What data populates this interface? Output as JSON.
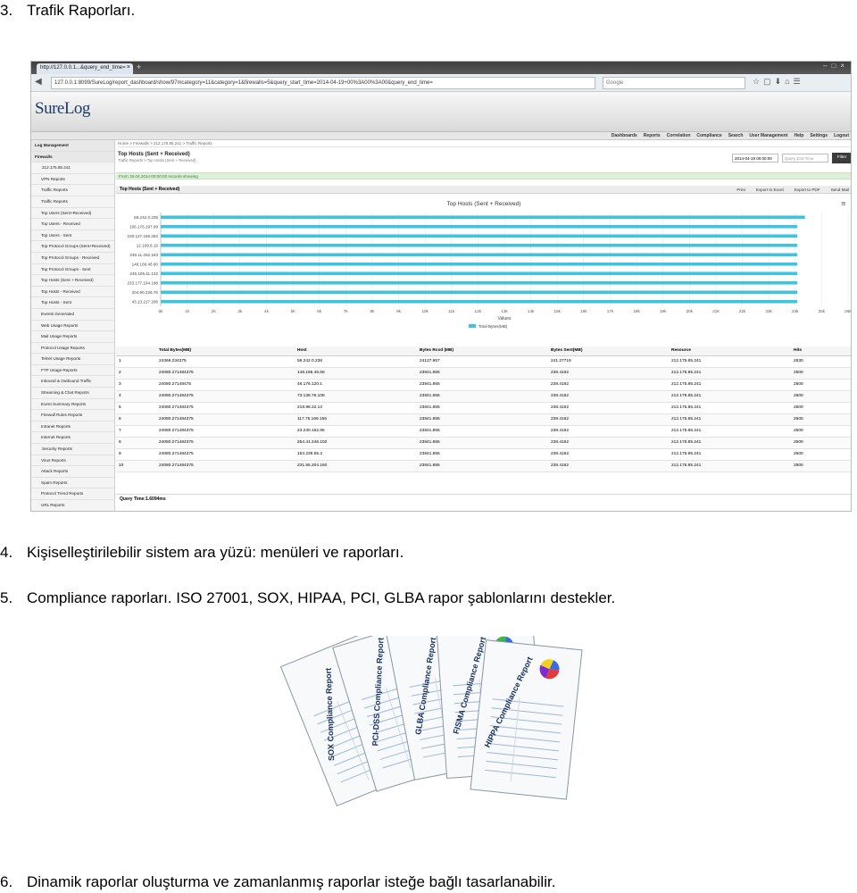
{
  "doc": {
    "item3": {
      "num": "3.",
      "text": "Trafik Raporları."
    },
    "item4": {
      "num": "4.",
      "text": "Kişiselleştirilebilir sistem ara yüzü: menüleri ve raporları."
    },
    "item5": {
      "num": "5.",
      "text": "Compliance raporları. ISO 27001, SOX, HIPAA, PCI, GLBA rapor şablonlarını destekler."
    },
    "item6": {
      "num": "6.",
      "text": "Dinamik raporlar oluşturma ve zamanlanmış raporlar isteğe bağlı tasarlanabilir."
    }
  },
  "browser": {
    "tab_title": "http://127.0.0.1...&query_end_time=",
    "url": "127.0.0.1:8099/SureLog/report_dashboard/show/97mcategory=11&category=1&firewalls=5&query_start_time=2014-04-19+00%3A00%3A00&query_end_time=",
    "search_placeholder": "Google"
  },
  "app": {
    "logo": "SureLog",
    "nav": [
      "Dashboards",
      "Reports",
      "Correlation",
      "Compliance",
      "Search",
      "User Management",
      "Help",
      "Settings",
      "Logout"
    ],
    "sidebar": [
      {
        "label": "Log Management",
        "kind": "head"
      },
      {
        "label": "Firewalls",
        "kind": "head"
      },
      {
        "label": "212.175.85.241",
        "kind": "item"
      },
      {
        "label": "VPN Reports",
        "kind": "sub"
      },
      {
        "label": "Traffic Reports",
        "kind": "sub"
      },
      {
        "label": "Traffic Reports",
        "kind": "sub"
      },
      {
        "label": "Top Users (Sent+Received)",
        "kind": "sub"
      },
      {
        "label": "Top Users - Received",
        "kind": "sub"
      },
      {
        "label": "Top Users - Sent",
        "kind": "sub"
      },
      {
        "label": "Top Protocol Groups (Sent+Received)",
        "kind": "sub"
      },
      {
        "label": "Top Protocol Groups - Received",
        "kind": "sub"
      },
      {
        "label": "Top Protocol Groups - Sent",
        "kind": "sub"
      },
      {
        "label": "Top Hosts (Sent + Received)",
        "kind": "sub"
      },
      {
        "label": "Top Hosts - Received",
        "kind": "sub"
      },
      {
        "label": "Top Hosts - Sent",
        "kind": "sub"
      },
      {
        "label": "Events Generated",
        "kind": "sub"
      },
      {
        "label": "Web Usage Reports",
        "kind": "sub"
      },
      {
        "label": "Mail Usage Reports",
        "kind": "sub"
      },
      {
        "label": "Protocol Usage Reports",
        "kind": "sub"
      },
      {
        "label": "Telnet Usage Reports",
        "kind": "sub"
      },
      {
        "label": "FTP Usage Reports",
        "kind": "sub"
      },
      {
        "label": "Inbound & Outbound Traffic",
        "kind": "sub"
      },
      {
        "label": "Streaming & Chat Reports",
        "kind": "sub"
      },
      {
        "label": "Event Summary Reports",
        "kind": "sub"
      },
      {
        "label": "Firewall Rules Reports",
        "kind": "sub"
      },
      {
        "label": "Intranet Reports",
        "kind": "sub"
      },
      {
        "label": "Internet Reports",
        "kind": "sub"
      },
      {
        "label": "Security Reports",
        "kind": "item"
      },
      {
        "label": "Virus Reports",
        "kind": "sub"
      },
      {
        "label": "Attack Reports",
        "kind": "sub"
      },
      {
        "label": "Spam Reports",
        "kind": "sub"
      },
      {
        "label": "Protocol Trend Reports",
        "kind": "sub"
      },
      {
        "label": "URL Reports",
        "kind": "sub"
      }
    ],
    "breadcrumb": "Home  >  Firewalls  >  212.175.85.241  >  Traffic Reports",
    "report_title": "Top Hosts (Sent + Received)",
    "report_sub": "Traffic Reports > Top Hosts (Sent + Received)",
    "query_start": "2014-04-19 00:00:00",
    "query_end_placeholder": "Query End Time",
    "filter_label": "Filter",
    "records_msg": "From 19.04.2014 00:00:00 records showing",
    "panel_title": "Top Hosts (Sent + Received)",
    "actions": [
      "Print",
      "Export to Excel",
      "Export to PDF",
      "Send Mail"
    ],
    "query_time": "Query Time:1.6094ms",
    "table": {
      "headers": [
        "",
        "Total Bytes(MB)",
        "Host",
        "Bytes Rcvd (MB)",
        "Bytes Sent(MB)",
        "Resource",
        "Hits"
      ],
      "rows": [
        [
          "1",
          "24369.234375",
          "58.242.0.236",
          "24127.957",
          "241.27719",
          "212.175.85.241",
          "2530"
        ],
        [
          "2",
          "24080.271484375",
          "148.166.46.60",
          "23841.855",
          "238.4162",
          "212.175.85.241",
          "2500"
        ],
        [
          "3",
          "24080.27148475",
          "46.176.120.1",
          "23841.855",
          "238.4162",
          "212.175.85.241",
          "2500"
        ],
        [
          "4",
          "24080.271484375",
          "73.138.76.108",
          "23841.855",
          "238.4162",
          "212.175.85.241",
          "2500"
        ],
        [
          "5",
          "24080.271484375",
          "219.98.22.12",
          "23841.855",
          "238.4162",
          "212.175.85.241",
          "2500"
        ],
        [
          "6",
          "24080.271484375",
          "117.75.169.156",
          "23841.855",
          "238.4162",
          "212.175.85.241",
          "2500"
        ],
        [
          "7",
          "24080.271484375",
          "23.230.162.65",
          "23841.855",
          "238.4162",
          "212.175.85.241",
          "2500"
        ],
        [
          "8",
          "24080.271484375",
          "254.41.246.102",
          "23841.855",
          "238.4162",
          "212.175.85.241",
          "2500"
        ],
        [
          "9",
          "24080.271484375",
          "153.239.55.2",
          "23841.855",
          "238.4162",
          "212.175.85.241",
          "2500"
        ],
        [
          "10",
          "24080.271484375",
          "231.55.204.160",
          "23841.855",
          "238.4162",
          "212.175.85.241",
          "2500"
        ]
      ]
    }
  },
  "chart_data": {
    "type": "bar",
    "orientation": "horizontal",
    "title": "Top Hosts (Sent + Received)",
    "xlabel": "Values",
    "categories": [
      "58.242.0.235",
      "106.176.197.99",
      "100.127.156.253",
      "12.169.6.19",
      "246.11.252.183",
      "148.166.46.60",
      "245.105.11.132",
      "233.177.104.188",
      "204.90.225.76",
      "43.13.217.206"
    ],
    "series": [
      {
        "name": "Total Bytes(MB)",
        "values": [
          24369.23,
          24080.27,
          24080.27,
          24080.27,
          24080.27,
          24080.27,
          24080.27,
          24080.27,
          24080.27,
          24080.27
        ]
      }
    ],
    "x_ticks": [
      "0k",
      "1k",
      "2k",
      "3k",
      "4k",
      "5k",
      "6k",
      "7k",
      "8k",
      "9k",
      "10k",
      "11k",
      "12k",
      "13k",
      "14k",
      "15k",
      "16k",
      "17k",
      "18k",
      "19k",
      "20k",
      "21k",
      "22k",
      "23k",
      "24k",
      "25k",
      "26k"
    ],
    "xlim": [
      0,
      26000
    ],
    "legend": "Total Bytes(MB)",
    "legend_position": "bottom",
    "bar_color": "#3ec3e0",
    "grid": true
  },
  "illustration": {
    "reports": [
      "SOX Compliance Report",
      "PCI-DSS Compliance Report",
      "GLBA Compliance Report",
      "FISMA Compliance Report",
      "HIPPA Compliance Report"
    ]
  }
}
